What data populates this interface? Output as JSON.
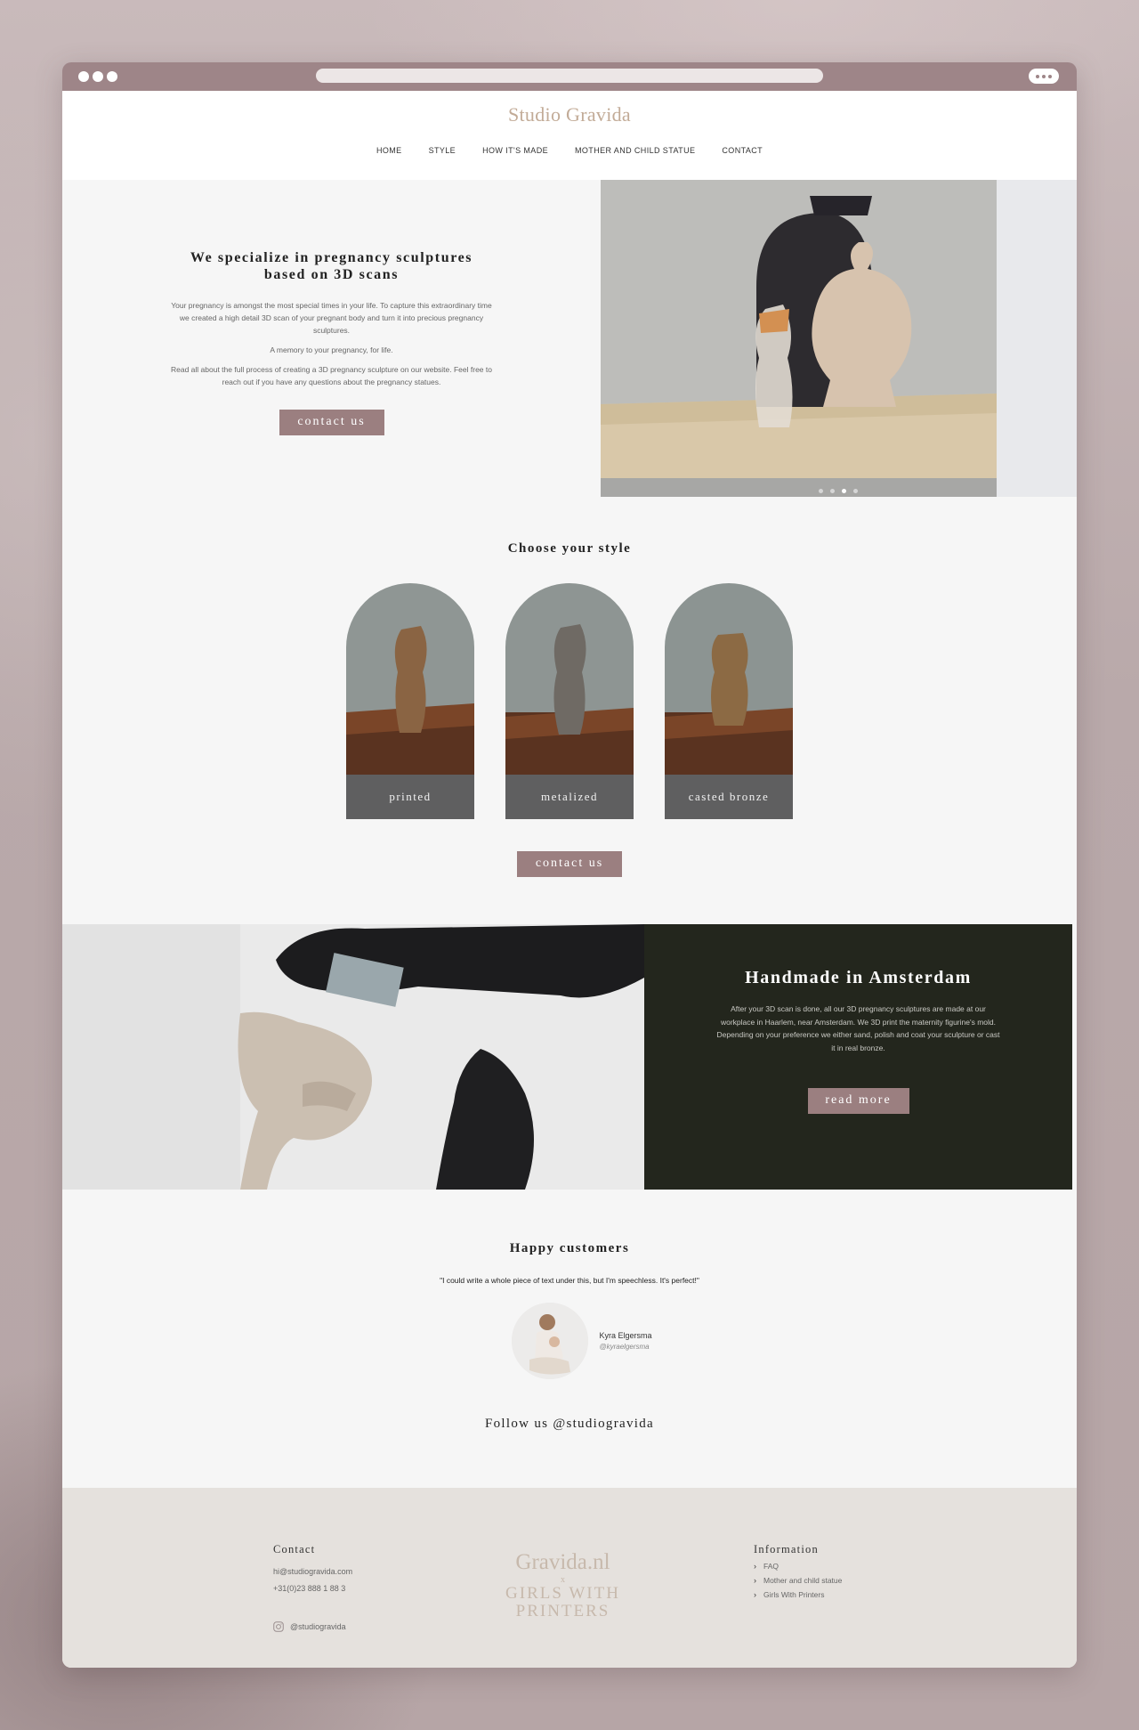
{
  "site": {
    "brand": "Studio Gravida",
    "nav": [
      "HOME",
      "STYLE",
      "HOW IT'S MADE",
      "MOTHER AND CHILD STATUE",
      "CONTACT"
    ]
  },
  "hero": {
    "title": "We specialize in pregnancy sculptures based on 3D scans",
    "p1": "Your pregnancy is amongst the most special times in your life. To capture this extraordinary time we created a high detail 3D scan of your pregnant body and turn it into precious pregnancy sculptures.",
    "p2": "A memory to your pregnancy, for life.",
    "p3": "Read all about the full process of creating a 3D pregnancy sculpture on our website. Feel free to reach out if you have any questions about the pregnancy statues.",
    "button": "contact us",
    "slides_total": 4,
    "slide_active": 3
  },
  "styles": {
    "title": "Choose your style",
    "cards": [
      {
        "label": "printed"
      },
      {
        "label": "metalized"
      },
      {
        "label": "casted bronze"
      }
    ],
    "button": "contact us"
  },
  "handmade": {
    "title": "Handmade in Amsterdam",
    "text": "After your 3D scan is done, all our 3D pregnancy sculptures are made at our workplace in Haarlem, near Amsterdam. We 3D print the maternity figurine's mold. Depending on your preference we either sand, polish and coat your sculpture or cast it in real bronze.",
    "button": "read more"
  },
  "testimonials": {
    "title": "Happy customers",
    "quote": "\"I could write a whole piece of text under this, but I'm speechless. It's perfect!\"",
    "name": "Kyra Elgersma",
    "handle": "@kyraelgersma",
    "follow": "Follow us @studiogravida"
  },
  "footer": {
    "contact_title": "Contact",
    "email": "hi@studiogravida.com",
    "phone": "+31(0)23 888 1 88 3",
    "instagram": "@studiogravida",
    "logo_top": "Gravida.nl",
    "logo_x": "x",
    "logo_bottom_1": "GIRLS WITH",
    "logo_bottom_2": "PRINTERS",
    "info_title": "Information",
    "info_links": [
      "FAQ",
      "Mother and child statue",
      "Girls With Printers"
    ]
  },
  "colors": {
    "accent": "#9b7f80",
    "brand": "#c2ab97",
    "dark_panel": "#23261d",
    "chrome": "#9e8588"
  }
}
